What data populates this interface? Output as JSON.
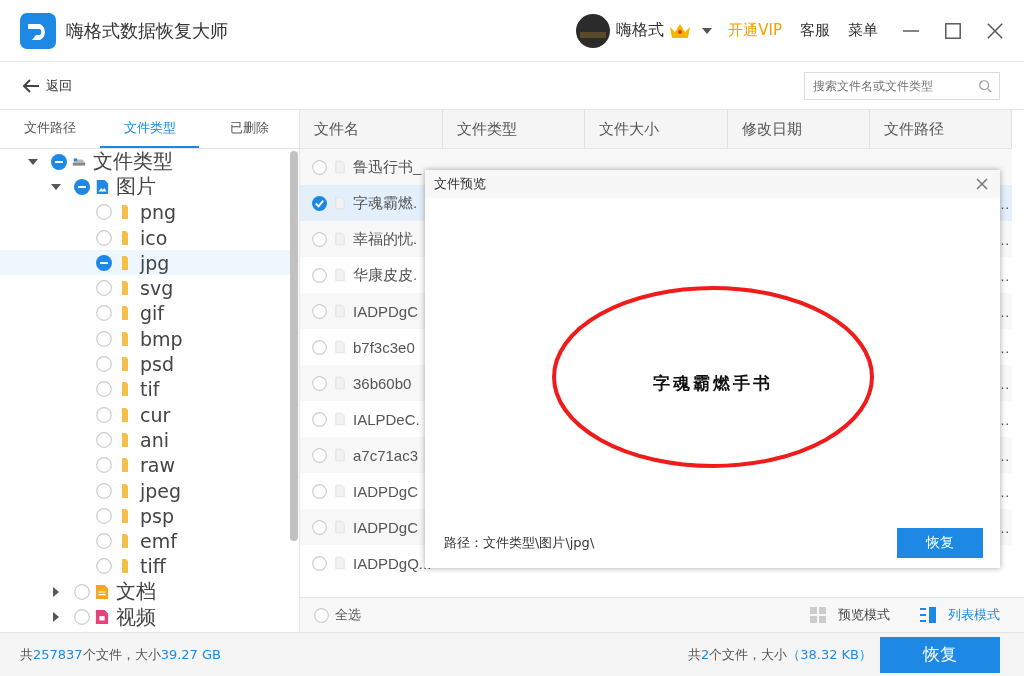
{
  "window": {
    "title": "嗨格式数据恢复大师",
    "user": "嗨格式",
    "vip_link": "开通VIP",
    "menu_items": [
      "客服",
      "菜单"
    ]
  },
  "toolbar": {
    "back": "返回",
    "search": {
      "placeholder": "搜索文件名或文件类型"
    }
  },
  "tabs": [
    {
      "label": "文件路径",
      "selected": false
    },
    {
      "label": "文件类型",
      "selected": true
    },
    {
      "label": "已删除",
      "selected": false
    }
  ],
  "tree": [
    {
      "label": "文件类型",
      "kind": "drive",
      "partial": true,
      "expanded": true,
      "selected": false,
      "children": [
        {
          "label": "图片",
          "kind": "image",
          "partial": true,
          "expanded": true,
          "selected": false,
          "children": [
            {
              "label": "png",
              "kind": "folder",
              "partial": false,
              "selected": false
            },
            {
              "label": "ico",
              "kind": "folder",
              "partial": false,
              "selected": false
            },
            {
              "label": "jpg",
              "kind": "folder",
              "partial": true,
              "selected": true
            },
            {
              "label": "svg",
              "kind": "folder",
              "partial": false,
              "selected": false
            },
            {
              "label": "gif",
              "kind": "folder",
              "partial": false,
              "selected": false
            },
            {
              "label": "bmp",
              "kind": "folder",
              "partial": false,
              "selected": false
            },
            {
              "label": "psd",
              "kind": "folder",
              "partial": false,
              "selected": false
            },
            {
              "label": "tif",
              "kind": "folder",
              "partial": false,
              "selected": false
            },
            {
              "label": "cur",
              "kind": "folder",
              "partial": false,
              "selected": false
            },
            {
              "label": "ani",
              "kind": "folder",
              "partial": false,
              "selected": false
            },
            {
              "label": "raw",
              "kind": "folder",
              "partial": false,
              "selected": false
            },
            {
              "label": "jpeg",
              "kind": "folder",
              "partial": false,
              "selected": false
            },
            {
              "label": "psp",
              "kind": "folder",
              "partial": false,
              "selected": false
            },
            {
              "label": "emf",
              "kind": "folder",
              "partial": false,
              "selected": false
            },
            {
              "label": "tiff",
              "kind": "folder",
              "partial": false,
              "selected": false
            }
          ]
        },
        {
          "label": "文档",
          "kind": "document",
          "partial": false,
          "expanded": false,
          "selected": false
        },
        {
          "label": "视频",
          "kind": "video",
          "partial": false,
          "expanded": false,
          "selected": false
        }
      ]
    }
  ],
  "table": {
    "columns": [
      "文件名",
      "文件类型",
      "文件大小",
      "修改日期",
      "文件路径"
    ],
    "rows": [
      {
        "name": "鲁迅行书_",
        "selected": false
      },
      {
        "name": "字魂霸燃.",
        "path": "…",
        "selected": true
      },
      {
        "name": "幸福的忧.",
        "path": "…",
        "selected": false
      },
      {
        "name": "华康皮皮.",
        "path": "…",
        "selected": false
      },
      {
        "name": "IADPDgC",
        "path": "…",
        "selected": false
      },
      {
        "name": "b7f3c3e0",
        "path": "…",
        "selected": false
      },
      {
        "name": "36b60b0",
        "path": "…",
        "selected": false
      },
      {
        "name": "IALPDeC.",
        "path": "…",
        "selected": false
      },
      {
        "name": "a7c71ac3",
        "path": "…",
        "selected": false
      },
      {
        "name": "IADPDgC",
        "path": "…",
        "selected": false
      },
      {
        "name": "IADPDgC",
        "path": "…",
        "selected": false
      },
      {
        "name": "IADPDgQ...",
        "selected": false
      }
    ],
    "select_all": {
      "label": "全选",
      "checked": false
    },
    "view_modes": [
      {
        "label": "预览模式",
        "kind": "grid",
        "selected": false
      },
      {
        "label": "列表模式",
        "kind": "list",
        "selected": true
      }
    ]
  },
  "preview": {
    "title": "文件预览",
    "image_text": "字魂霸燃手书",
    "path": "路径：文件类型\\图片\\jpg\\",
    "button": "恢复"
  },
  "status_bar": {
    "total": [
      {
        "text": "共",
        "highlight": false
      },
      {
        "text": "257837",
        "highlight": true
      },
      {
        "text": "个文件，大小",
        "highlight": false
      },
      {
        "text": "39.27 GB",
        "highlight": true
      }
    ],
    "selected": [
      {
        "text": "共",
        "highlight": false
      },
      {
        "text": "2",
        "highlight": true
      },
      {
        "text": "个文件，大小",
        "highlight": false
      },
      {
        "text": "（38.32 KB）",
        "highlight": true
      }
    ],
    "button": "恢复"
  }
}
